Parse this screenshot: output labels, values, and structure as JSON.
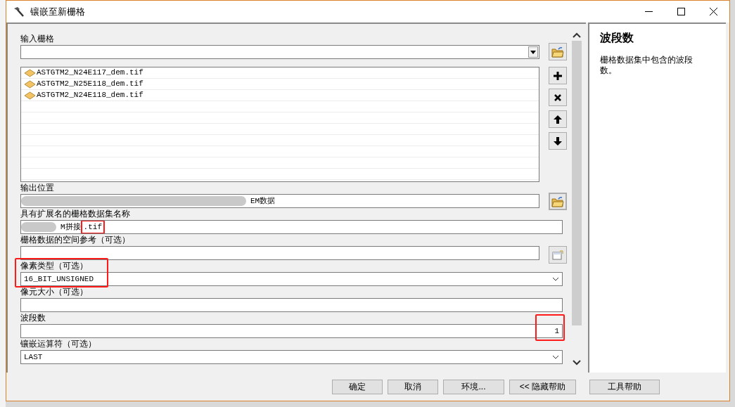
{
  "window": {
    "title": "镶嵌至新栅格"
  },
  "params": [
    {
      "kind": "multi",
      "label": "输入栅格",
      "items": [
        "ASTGTM2_N24E117_dem.tif",
        "ASTGTM2_N25E118_dem.tif",
        "ASTGTM2_N24E118_dem.tif"
      ]
    },
    {
      "kind": "path",
      "label": "输出位置",
      "value": "EM数据",
      "blurred": true,
      "highlighted": false
    },
    {
      "kind": "text",
      "label": "具有扩展名的栅格数据集名称",
      "value": "M拼接",
      "suffix": ".tif",
      "blurred": true,
      "highlighted": true
    },
    {
      "kind": "spatial",
      "label": "栅格数据的空间参考（可选）",
      "blurred": false,
      "highlighted": false
    },
    {
      "kind": "combo",
      "label": "像素类型（可选）",
      "value": "16_BIT_UNSIGNED",
      "blurred": false,
      "highlighted": true
    },
    {
      "kind": "text",
      "label": "像元大小（可选）",
      "blurred": false,
      "highlighted": false
    },
    {
      "kind": "number",
      "label": "波段数",
      "value": "1",
      "blurred": false,
      "highlighted": true
    },
    {
      "kind": "combo",
      "label": "镶嵌运算符（可选）",
      "value": "LAST",
      "blurred": false,
      "highlighted": false
    }
  ],
  "help": {
    "title": "波段数",
    "text": "栅格数据集中包含的波段数。"
  },
  "buttons": [
    "确定",
    "取消",
    "环境...",
    "<< 隐藏帮助",
    "工具帮助"
  ]
}
